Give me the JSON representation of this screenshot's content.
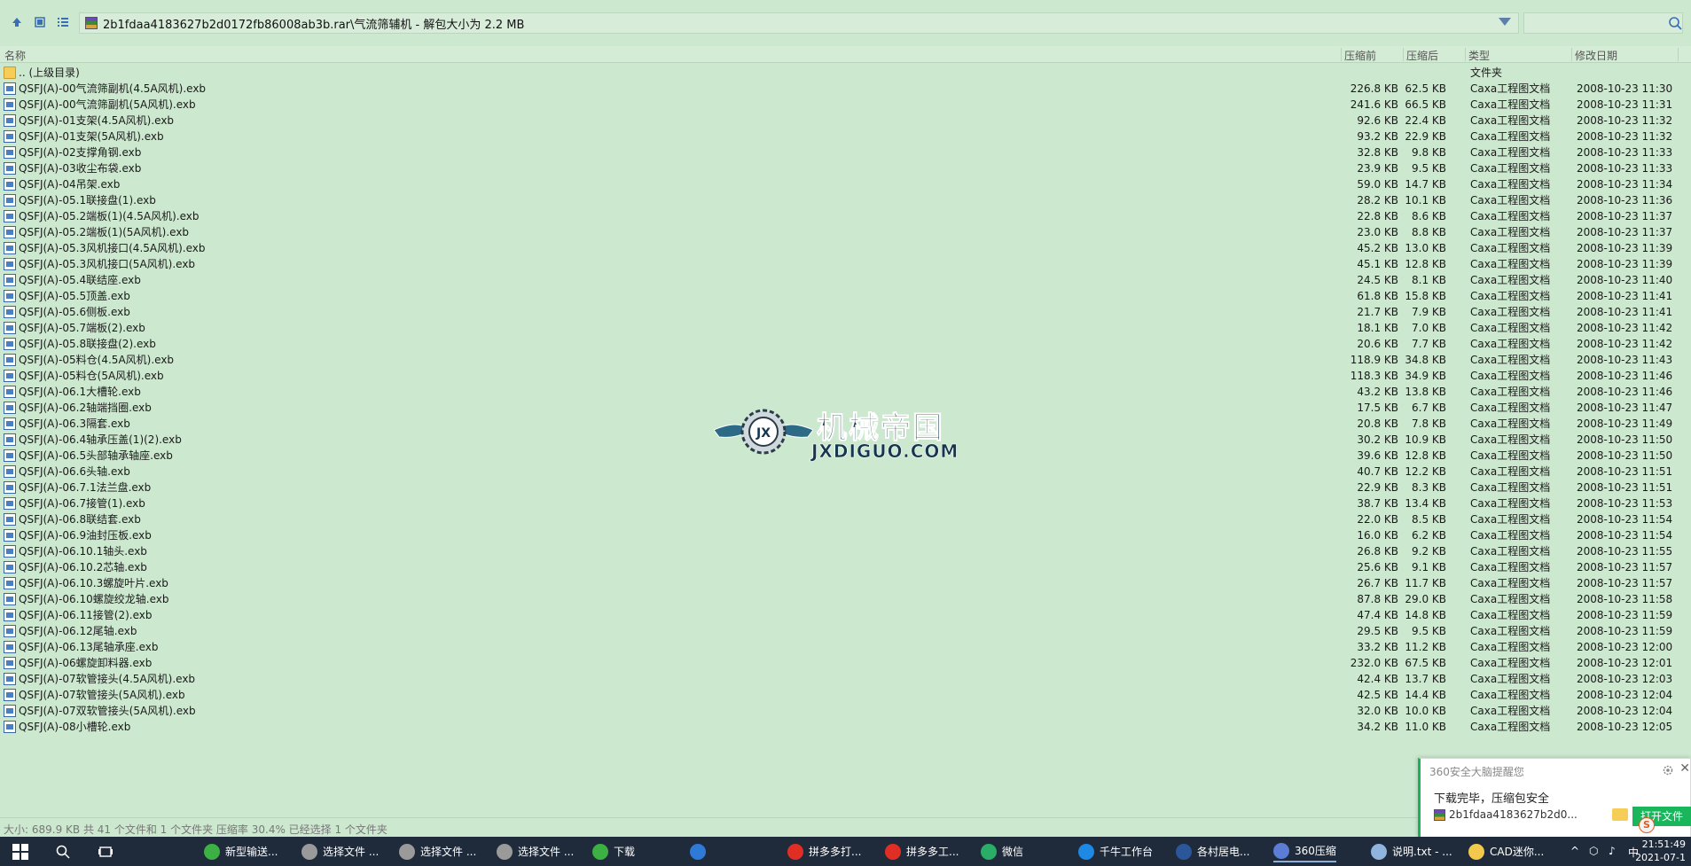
{
  "address": {
    "path": "2b1fdaa4183627b2d0172fb86008ab3b.rar\\气流筛辅机 - 解包大小为 2.2 MB"
  },
  "columns": {
    "name": "名称",
    "before": "压缩前",
    "after": "压缩后",
    "type": "类型",
    "modified": "修改日期"
  },
  "parent": {
    "name": ".. (上级目录)",
    "type": "文件夹"
  },
  "files": [
    {
      "name": "QSFJ(A)-00气流筛副机(4.5A风机).exb",
      "before": "226.8 KB",
      "after": "62.5 KB",
      "type": "Caxa工程图文档",
      "date": "2008-10-23 11:30"
    },
    {
      "name": "QSFJ(A)-00气流筛副机(5A风机).exb",
      "before": "241.6 KB",
      "after": "66.5 KB",
      "type": "Caxa工程图文档",
      "date": "2008-10-23 11:31"
    },
    {
      "name": "QSFJ(A)-01支架(4.5A风机).exb",
      "before": "92.6 KB",
      "after": "22.4 KB",
      "type": "Caxa工程图文档",
      "date": "2008-10-23 11:32"
    },
    {
      "name": "QSFJ(A)-01支架(5A风机).exb",
      "before": "93.2 KB",
      "after": "22.9 KB",
      "type": "Caxa工程图文档",
      "date": "2008-10-23 11:32"
    },
    {
      "name": "QSFJ(A)-02支撑角钢.exb",
      "before": "32.8 KB",
      "after": "9.8 KB",
      "type": "Caxa工程图文档",
      "date": "2008-10-23 11:33"
    },
    {
      "name": "QSFJ(A)-03收尘布袋.exb",
      "before": "23.9 KB",
      "after": "9.5 KB",
      "type": "Caxa工程图文档",
      "date": "2008-10-23 11:33"
    },
    {
      "name": "QSFJ(A)-04吊架.exb",
      "before": "59.0 KB",
      "after": "14.7 KB",
      "type": "Caxa工程图文档",
      "date": "2008-10-23 11:34"
    },
    {
      "name": "QSFJ(A)-05.1联接盘(1).exb",
      "before": "28.2 KB",
      "after": "10.1 KB",
      "type": "Caxa工程图文档",
      "date": "2008-10-23 11:36"
    },
    {
      "name": "QSFJ(A)-05.2端板(1)(4.5A风机).exb",
      "before": "22.8 KB",
      "after": "8.6 KB",
      "type": "Caxa工程图文档",
      "date": "2008-10-23 11:37"
    },
    {
      "name": "QSFJ(A)-05.2端板(1)(5A风机).exb",
      "before": "23.0 KB",
      "after": "8.8 KB",
      "type": "Caxa工程图文档",
      "date": "2008-10-23 11:37"
    },
    {
      "name": "QSFJ(A)-05.3风机接口(4.5A风机).exb",
      "before": "45.2 KB",
      "after": "13.0 KB",
      "type": "Caxa工程图文档",
      "date": "2008-10-23 11:39"
    },
    {
      "name": "QSFJ(A)-05.3风机接口(5A风机).exb",
      "before": "45.1 KB",
      "after": "12.8 KB",
      "type": "Caxa工程图文档",
      "date": "2008-10-23 11:39"
    },
    {
      "name": "QSFJ(A)-05.4联结座.exb",
      "before": "24.5 KB",
      "after": "8.1 KB",
      "type": "Caxa工程图文档",
      "date": "2008-10-23 11:40"
    },
    {
      "name": "QSFJ(A)-05.5顶盖.exb",
      "before": "61.8 KB",
      "after": "15.8 KB",
      "type": "Caxa工程图文档",
      "date": "2008-10-23 11:41"
    },
    {
      "name": "QSFJ(A)-05.6侧板.exb",
      "before": "21.7 KB",
      "after": "7.9 KB",
      "type": "Caxa工程图文档",
      "date": "2008-10-23 11:41"
    },
    {
      "name": "QSFJ(A)-05.7端板(2).exb",
      "before": "18.1 KB",
      "after": "7.0 KB",
      "type": "Caxa工程图文档",
      "date": "2008-10-23 11:42"
    },
    {
      "name": "QSFJ(A)-05.8联接盘(2).exb",
      "before": "20.6 KB",
      "after": "7.7 KB",
      "type": "Caxa工程图文档",
      "date": "2008-10-23 11:42"
    },
    {
      "name": "QSFJ(A)-05料仓(4.5A风机).exb",
      "before": "118.9 KB",
      "after": "34.8 KB",
      "type": "Caxa工程图文档",
      "date": "2008-10-23 11:43"
    },
    {
      "name": "QSFJ(A)-05料仓(5A风机).exb",
      "before": "118.3 KB",
      "after": "34.9 KB",
      "type": "Caxa工程图文档",
      "date": "2008-10-23 11:46"
    },
    {
      "name": "QSFJ(A)-06.1大槽轮.exb",
      "before": "43.2 KB",
      "after": "13.8 KB",
      "type": "Caxa工程图文档",
      "date": "2008-10-23 11:46"
    },
    {
      "name": "QSFJ(A)-06.2轴端挡圈.exb",
      "before": "17.5 KB",
      "after": "6.7 KB",
      "type": "Caxa工程图文档",
      "date": "2008-10-23 11:47"
    },
    {
      "name": "QSFJ(A)-06.3隔套.exb",
      "before": "20.8 KB",
      "after": "7.8 KB",
      "type": "Caxa工程图文档",
      "date": "2008-10-23 11:49"
    },
    {
      "name": "QSFJ(A)-06.4轴承压盖(1)(2).exb",
      "before": "30.2 KB",
      "after": "10.9 KB",
      "type": "Caxa工程图文档",
      "date": "2008-10-23 11:50"
    },
    {
      "name": "QSFJ(A)-06.5头部轴承轴座.exb",
      "before": "39.6 KB",
      "after": "12.8 KB",
      "type": "Caxa工程图文档",
      "date": "2008-10-23 11:50"
    },
    {
      "name": "QSFJ(A)-06.6头轴.exb",
      "before": "40.7 KB",
      "after": "12.2 KB",
      "type": "Caxa工程图文档",
      "date": "2008-10-23 11:51"
    },
    {
      "name": "QSFJ(A)-06.7.1法兰盘.exb",
      "before": "22.9 KB",
      "after": "8.3 KB",
      "type": "Caxa工程图文档",
      "date": "2008-10-23 11:51"
    },
    {
      "name": "QSFJ(A)-06.7接管(1).exb",
      "before": "38.7 KB",
      "after": "13.4 KB",
      "type": "Caxa工程图文档",
      "date": "2008-10-23 11:53"
    },
    {
      "name": "QSFJ(A)-06.8联结套.exb",
      "before": "22.0 KB",
      "after": "8.5 KB",
      "type": "Caxa工程图文档",
      "date": "2008-10-23 11:54"
    },
    {
      "name": "QSFJ(A)-06.9油封压板.exb",
      "before": "16.0 KB",
      "after": "6.2 KB",
      "type": "Caxa工程图文档",
      "date": "2008-10-23 11:54"
    },
    {
      "name": "QSFJ(A)-06.10.1轴头.exb",
      "before": "26.8 KB",
      "after": "9.2 KB",
      "type": "Caxa工程图文档",
      "date": "2008-10-23 11:55"
    },
    {
      "name": "QSFJ(A)-06.10.2芯轴.exb",
      "before": "25.6 KB",
      "after": "9.1 KB",
      "type": "Caxa工程图文档",
      "date": "2008-10-23 11:57"
    },
    {
      "name": "QSFJ(A)-06.10.3螺旋叶片.exb",
      "before": "26.7 KB",
      "after": "11.7 KB",
      "type": "Caxa工程图文档",
      "date": "2008-10-23 11:57"
    },
    {
      "name": "QSFJ(A)-06.10螺旋绞龙轴.exb",
      "before": "87.8 KB",
      "after": "29.0 KB",
      "type": "Caxa工程图文档",
      "date": "2008-10-23 11:58"
    },
    {
      "name": "QSFJ(A)-06.11接管(2).exb",
      "before": "47.4 KB",
      "after": "14.8 KB",
      "type": "Caxa工程图文档",
      "date": "2008-10-23 11:59"
    },
    {
      "name": "QSFJ(A)-06.12尾轴.exb",
      "before": "29.5 KB",
      "after": "9.5 KB",
      "type": "Caxa工程图文档",
      "date": "2008-10-23 11:59"
    },
    {
      "name": "QSFJ(A)-06.13尾轴承座.exb",
      "before": "33.2 KB",
      "after": "11.2 KB",
      "type": "Caxa工程图文档",
      "date": "2008-10-23 12:00"
    },
    {
      "name": "QSFJ(A)-06螺旋卸料器.exb",
      "before": "232.0 KB",
      "after": "67.5 KB",
      "type": "Caxa工程图文档",
      "date": "2008-10-23 12:01"
    },
    {
      "name": "QSFJ(A)-07软管接头(4.5A风机).exb",
      "before": "42.4 KB",
      "after": "13.7 KB",
      "type": "Caxa工程图文档",
      "date": "2008-10-23 12:03"
    },
    {
      "name": "QSFJ(A)-07软管接头(5A风机).exb",
      "before": "42.5 KB",
      "after": "14.4 KB",
      "type": "Caxa工程图文档",
      "date": "2008-10-23 12:04"
    },
    {
      "name": "QSFJ(A)-07双软管接头(5A风机).exb",
      "before": "32.0 KB",
      "after": "10.0 KB",
      "type": "Caxa工程图文档",
      "date": "2008-10-23 12:04"
    },
    {
      "name": "QSFJ(A)-08小槽轮.exb",
      "before": "34.2 KB",
      "after": "11.0 KB",
      "type": "Caxa工程图文档",
      "date": "2008-10-23 12:05"
    }
  ],
  "watermark": {
    "cn": "机械帝国",
    "en": "JXDIGUO.COM"
  },
  "status": "大小: 689.9 KB 共 41 个文件和 1 个文件夹 压缩率 30.4% 已经选择 1 个文件夹",
  "popup": {
    "title": "360安全大脑提醒您",
    "message": "下载完毕，压缩包安全",
    "file": "2b1fdaa4183627b2d0...",
    "open_label": "打开文件"
  },
  "taskbar": {
    "items": [
      {
        "label": "新型输送...",
        "color": "#3cb043"
      },
      {
        "label": "选择文件 ...",
        "color": "#9a9a9a"
      },
      {
        "label": "选择文件 ...",
        "color": "#9a9a9a"
      },
      {
        "label": "选择文件 ...",
        "color": "#9a9a9a"
      },
      {
        "label": "下载",
        "color": "#3cb043"
      },
      {
        "label": "",
        "color": "#2f7ad6"
      },
      {
        "label": "拼多多打...",
        "color": "#e02e24"
      },
      {
        "label": "拼多多工...",
        "color": "#e02e24"
      },
      {
        "label": "微信",
        "color": "#2aae67"
      },
      {
        "label": "千牛工作台",
        "color": "#1e88e5"
      },
      {
        "label": "各村居电...",
        "color": "#2b579a"
      },
      {
        "label": "360压缩",
        "color": "#5b7dd6"
      },
      {
        "label": "说明.txt - ...",
        "color": "#8fb4dd"
      },
      {
        "label": "CAD迷你...",
        "color": "#f2c94c"
      }
    ],
    "time": "21:51:49",
    "date": "2021-07-1"
  }
}
